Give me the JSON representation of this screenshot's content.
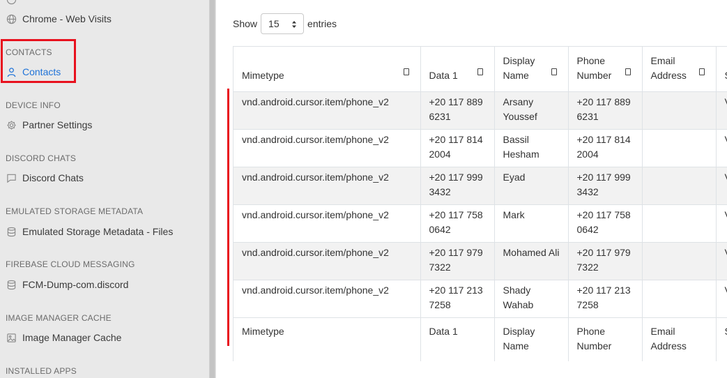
{
  "sidebar": {
    "partial_item": {
      "label": "Chrome - Web Visits"
    },
    "sections": [
      {
        "title": "CONTACTS",
        "item": "Contacts",
        "icon": "person-icon",
        "active": true
      },
      {
        "title": "DEVICE INFO",
        "item": "Partner Settings",
        "icon": "gear-icon"
      },
      {
        "title": "DISCORD CHATS",
        "item": "Discord Chats",
        "icon": "chat-bubble-icon"
      },
      {
        "title": "EMULATED STORAGE METADATA",
        "item": "Emulated Storage Metadata - Files",
        "icon": "database-icon"
      },
      {
        "title": "FIREBASE CLOUD MESSAGING",
        "item": "FCM-Dump-com.discord",
        "icon": "database-icon"
      },
      {
        "title": "IMAGE MANAGER CACHE",
        "item": "Image Manager Cache",
        "icon": "image-icon"
      },
      {
        "title": "INSTALLED APPS",
        "item": "",
        "icon": ""
      }
    ],
    "accent_color": "#1f73d8",
    "highlight_color": "#e8111e"
  },
  "length_control": {
    "show_label": "Show",
    "value": "15",
    "entries_label": "entries"
  },
  "table": {
    "headers": [
      "Mimetype",
      "Data 1",
      "Display Name",
      "Phone Number",
      "Email Address",
      "S"
    ],
    "rows": [
      [
        "vnd.android.cursor.item/phone_v2",
        "+20 117 889 6231",
        "Arsany Youssef",
        "+20 117 889 6231",
        "",
        "V"
      ],
      [
        "vnd.android.cursor.item/phone_v2",
        "+20 117 814 2004",
        "Bassil Hesham",
        "+20 117 814 2004",
        "",
        "V"
      ],
      [
        "vnd.android.cursor.item/phone_v2",
        "+20 117 999 3432",
        "Eyad",
        "+20 117 999 3432",
        "",
        "V"
      ],
      [
        "vnd.android.cursor.item/phone_v2",
        "+20 117 758 0642",
        "Mark",
        "+20 117 758 0642",
        "",
        "V"
      ],
      [
        "vnd.android.cursor.item/phone_v2",
        "+20 117 979 7322",
        "Mohamed Ali",
        "+20 117 979 7322",
        "",
        "V"
      ],
      [
        "vnd.android.cursor.item/phone_v2",
        "+20 117 213 7258",
        "Shady Wahab",
        "+20 117 213 7258",
        "",
        "V"
      ]
    ],
    "footers": [
      "Mimetype",
      "Data 1",
      "Display Name",
      "Phone Number",
      "Email Address",
      "S"
    ]
  }
}
